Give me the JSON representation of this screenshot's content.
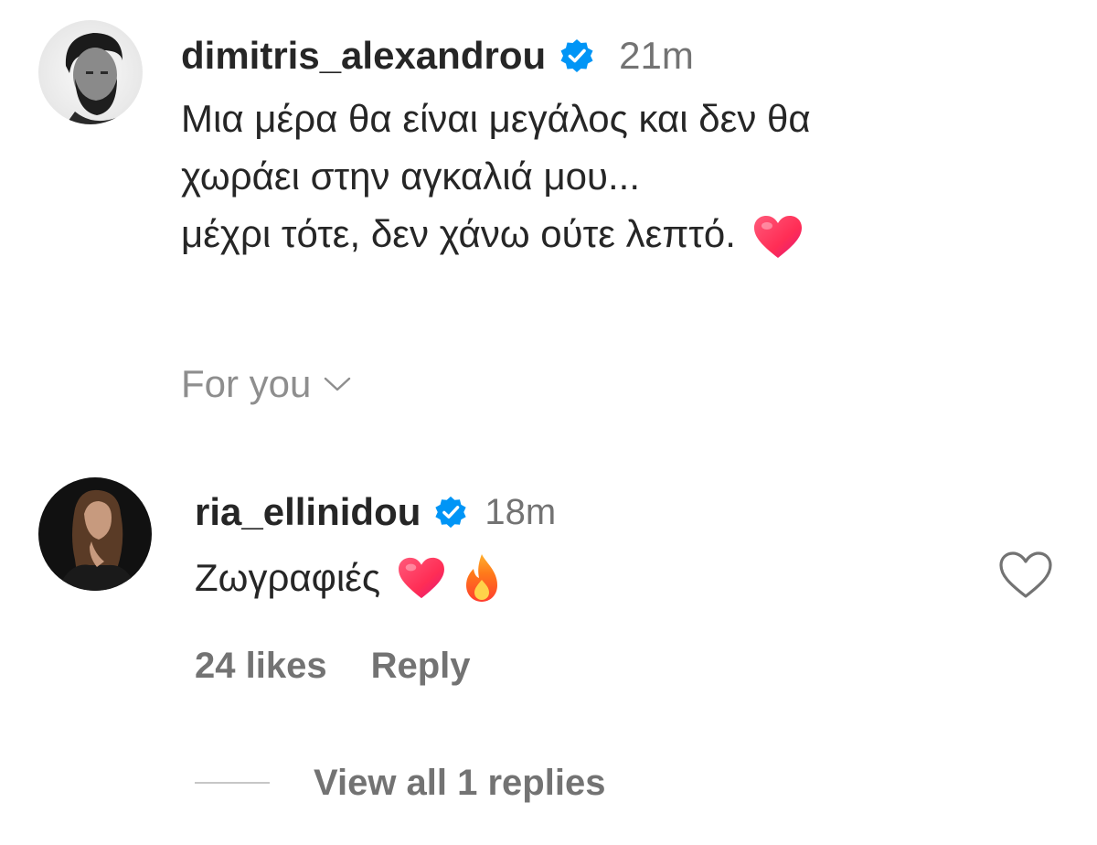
{
  "post": {
    "username": "dimitris_alexandrou",
    "verified_icon": "verified-badge-icon",
    "timestamp": "21m",
    "caption_lines": [
      "Μια μέρα θα είναι μεγάλος και δεν θα",
      "χωράει στην αγκαλιά μου...",
      "μέχρι τότε, δεν χάνω ούτε λεπτό."
    ],
    "caption_emoji": "heart-emoji"
  },
  "sort": {
    "label": "For you",
    "icon": "chevron-down-icon"
  },
  "comment": {
    "username": "ria_ellinidou",
    "verified_icon": "verified-badge-icon",
    "timestamp": "18m",
    "text": "Ζωγραφιές",
    "emojis": [
      "heart-emoji",
      "fire-emoji"
    ],
    "likes_label": "24 likes",
    "reply_label": "Reply",
    "view_replies_label": "View all 1 replies",
    "like_icon": "heart-outline-icon"
  },
  "colors": {
    "text": "#262626",
    "secondary": "#737373",
    "verified": "#0095f6",
    "divider": "#c7c7c7"
  }
}
